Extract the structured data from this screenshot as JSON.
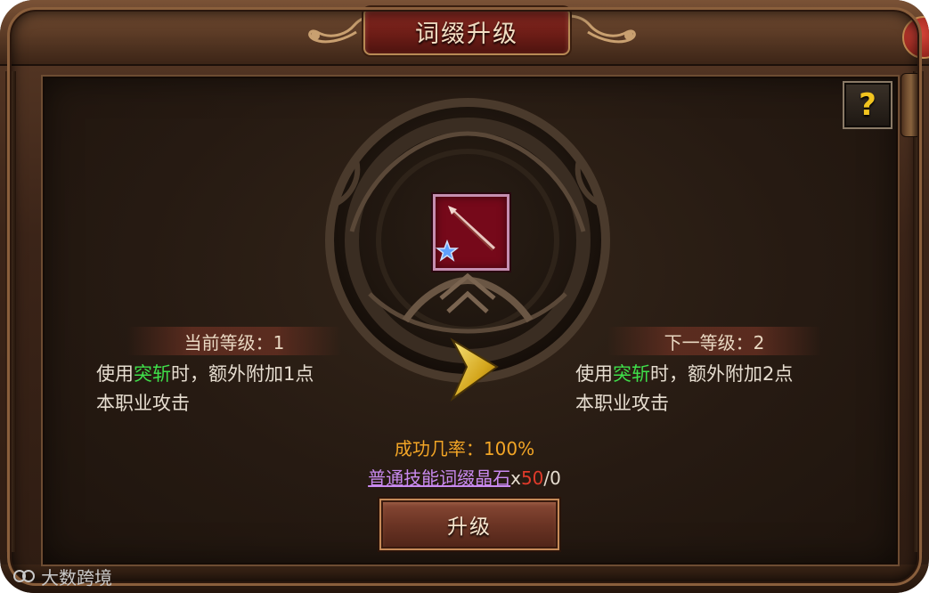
{
  "window": {
    "title": "词缀升级"
  },
  "help": {
    "label": "?"
  },
  "item": {
    "icon": "spear-icon",
    "badge": "star-icon"
  },
  "current": {
    "level_label": "当前等级：1",
    "desc_pre": "使用",
    "skill": "突斩",
    "desc_post": "时，额外附加1点",
    "desc_line2": "本职业攻击"
  },
  "next": {
    "level_label": "下一等级：2",
    "desc_pre": "使用",
    "skill": "突斩",
    "desc_post": "时，额外附加2点",
    "desc_line2": "本职业攻击"
  },
  "success": {
    "text": "成功几率：100%"
  },
  "material": {
    "name": "普通技能词缀晶石",
    "x": "x",
    "need": "50",
    "sep": "/",
    "have": "0"
  },
  "actions": {
    "upgrade_label": "升级"
  },
  "watermark": {
    "text": "大数跨境"
  },
  "colors": {
    "skill_highlight": "#3fe04a",
    "success_rate": "#f2a526",
    "material_link": "#c98af0",
    "insufficient": "#e03a2a",
    "help_icon": "#f2c41f"
  }
}
